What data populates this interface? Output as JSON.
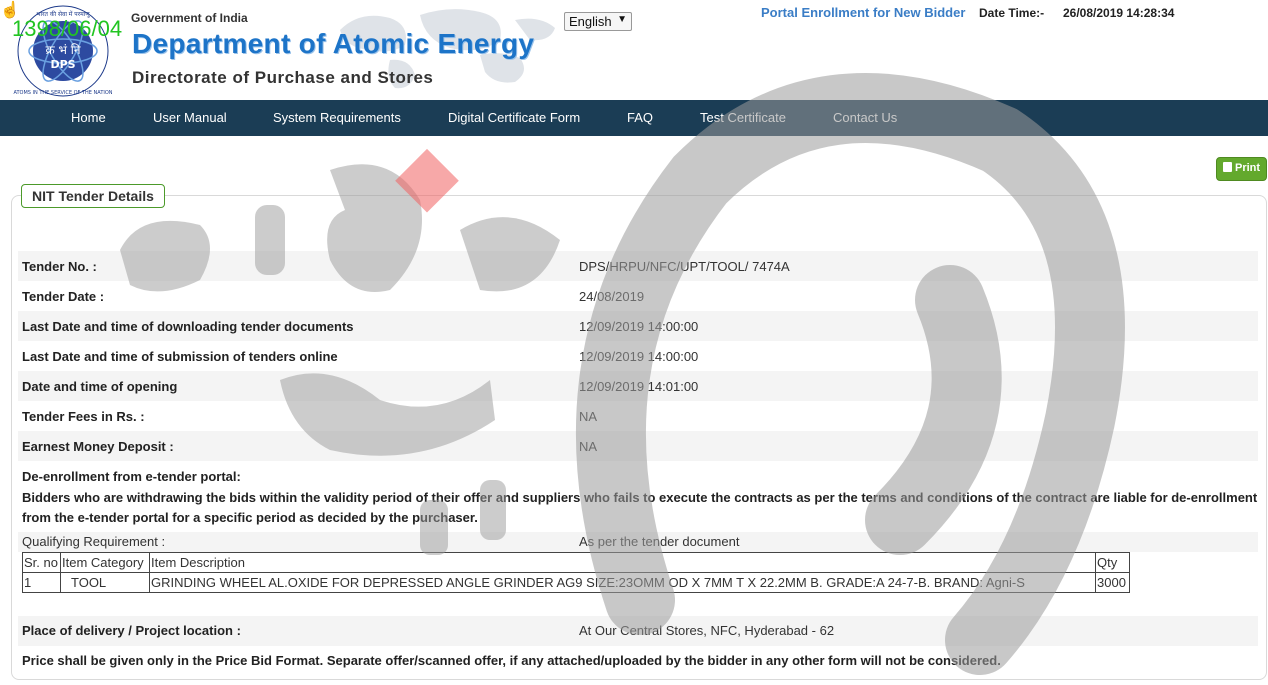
{
  "header": {
    "logo_text_top": "भारत की सेवा में परमाणु",
    "logo_text_mid": "क्र भं नि",
    "logo_text_dps": "DPS",
    "logo_text_bottom": "ATOMS IN THE SERVICE OF THE NATION",
    "stamp": "1398/06/04",
    "gov": "Government of India",
    "dept": "Department of Atomic Energy",
    "directorate": "Directorate of Purchase and Stores",
    "language": "English",
    "enroll_link": "Portal Enrollment for New Bidder",
    "datetime_label": "Date Time:-",
    "datetime_value": "26/08/2019 14:28:34"
  },
  "nav": {
    "items": [
      "Home",
      "User Manual",
      "System Requirements",
      "Digital Certificate Form",
      "FAQ",
      "Test Certificate",
      "Contact Us"
    ]
  },
  "print_label": "Print",
  "panel": {
    "title": "NIT Tender Details",
    "rows": [
      {
        "label": "Tender No. :",
        "value": "DPS/HRPU/NFC/UPT/TOOL/ 7474A"
      },
      {
        "label": "Tender Date :",
        "value": "24/08/2019"
      },
      {
        "label": "Last Date and time of downloading tender documents",
        "value": "12/09/2019 14:00:00"
      },
      {
        "label": "Last Date and time of submission of tenders online",
        "value": "12/09/2019 14:00:00"
      },
      {
        "label": "Date and time of opening",
        "value": "12/09/2019 14:01:00"
      },
      {
        "label": "Tender Fees in Rs. :",
        "value": "NA"
      },
      {
        "label": "Earnest Money Deposit :",
        "value": "NA"
      }
    ],
    "deenroll_title": "De-enrollment from e-tender portal:",
    "deenroll_text": "Bidders who are withdrawing the bids within the validity period of their offer and suppliers who fails to execute the contracts as per the terms and conditions of the contract are liable for de-enrollment from the e-tender portal for a specific period as decided by the purchaser.",
    "qualifying_label": "Qualifying Requirement :",
    "qualifying_value": "As per the tender document",
    "table": {
      "headers": [
        "Sr. no",
        "Item Category",
        "Item Description",
        "Qty"
      ],
      "rows": [
        [
          "1",
          "TOOL",
          "GRINDING WHEEL AL.OXIDE FOR DEPRESSED ANGLE GRINDER AG9 SIZE:23OMM OD X 7MM T X 22.2MM B. GRADE:A 24-7-B. BRAND: Agni-S",
          "3000"
        ]
      ]
    },
    "delivery_label": "Place of delivery / Project location :",
    "delivery_value": "At Our Central Stores, NFC, Hyderabad - 62",
    "note": "Price shall be given only in the Price Bid Format. Separate offer/scanned offer, if any attached/uploaded by the bidder in any other form will not be considered."
  },
  "colors": {
    "navbar": "#1b3d55",
    "dept_blue": "#1d74c8",
    "print_green": "#63a92d",
    "legend_border": "#4c9a2a"
  }
}
